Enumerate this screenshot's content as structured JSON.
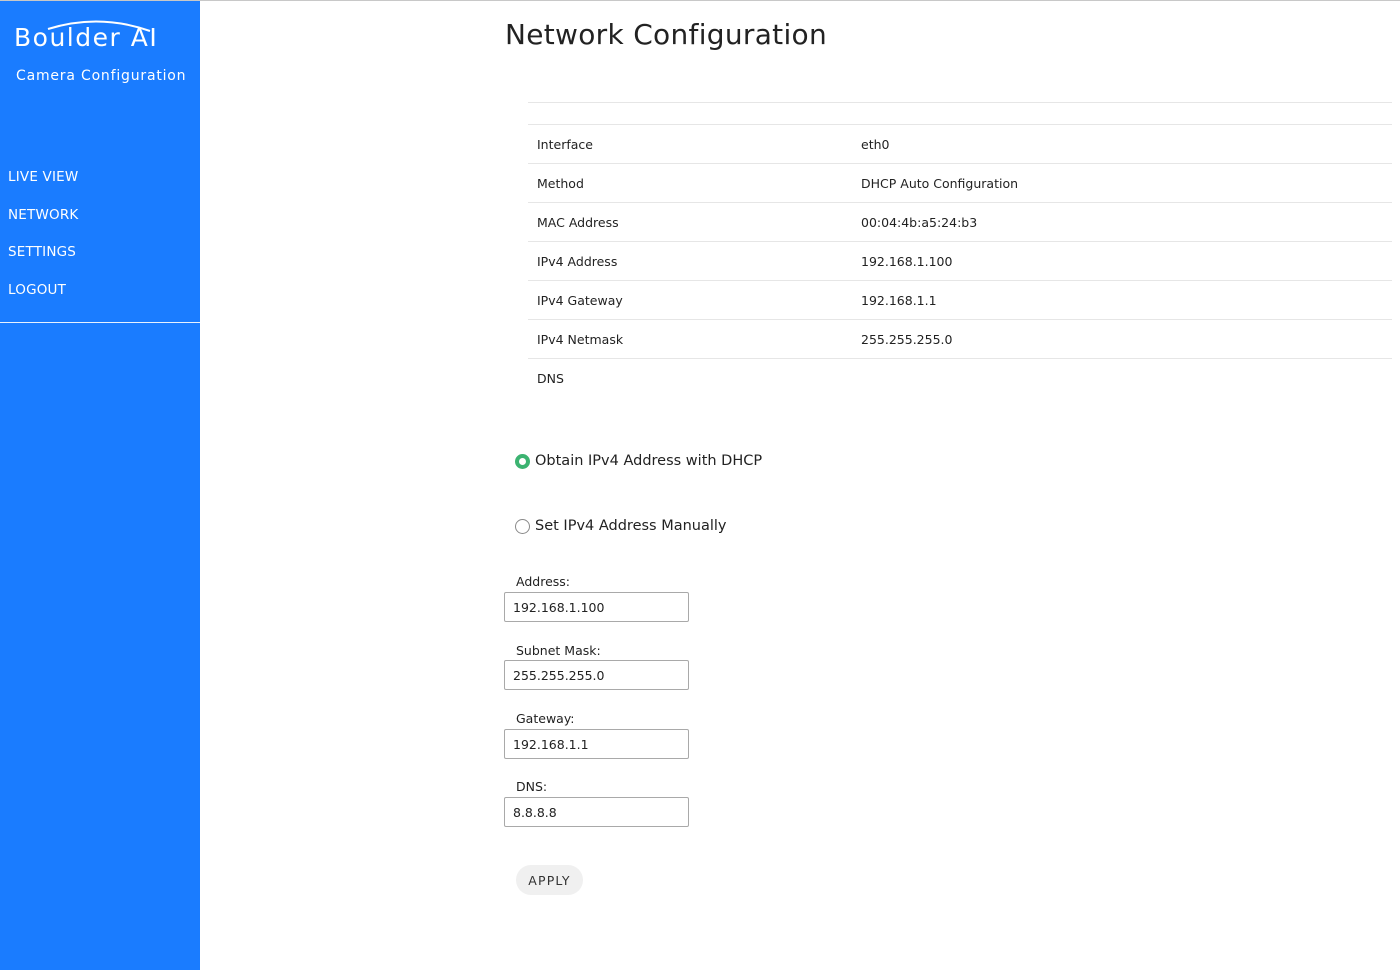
{
  "sidebar": {
    "brand": "Boulder AI",
    "subtitle": "Camera Configuration",
    "nav": [
      {
        "label": "LIVE VIEW"
      },
      {
        "label": "NETWORK"
      },
      {
        "label": "SETTINGS"
      },
      {
        "label": "LOGOUT"
      }
    ]
  },
  "main": {
    "title": "Network Configuration",
    "info_rows": [
      {
        "key": "Interface",
        "value": "eth0"
      },
      {
        "key": "Method",
        "value": "DHCP Auto Configuration"
      },
      {
        "key": "MAC Address",
        "value": "00:04:4b:a5:24:b3"
      },
      {
        "key": "IPv4 Address",
        "value": "192.168.1.100"
      },
      {
        "key": "IPv4 Gateway",
        "value": "192.168.1.1"
      },
      {
        "key": "IPv4 Netmask",
        "value": "255.255.255.0"
      },
      {
        "key": "DNS",
        "value": ""
      }
    ],
    "mode_options": [
      {
        "label": "Obtain IPv4 Address with DHCP",
        "selected": true
      },
      {
        "label": "Set IPv4 Address Manually",
        "selected": false
      }
    ],
    "fields": {
      "address": {
        "label": "Address:",
        "value": "192.168.1.100"
      },
      "subnet": {
        "label": "Subnet Mask:",
        "value": "255.255.255.0"
      },
      "gateway": {
        "label": "Gateway:",
        "value": "192.168.1.1"
      },
      "dns": {
        "label": "DNS:",
        "value": "8.8.8.8"
      }
    },
    "apply_label": "APPLY"
  },
  "colors": {
    "sidebar_bg": "#1a7cff",
    "radio_selected": "#3cb371",
    "button_bg": "#f0f0f0"
  }
}
